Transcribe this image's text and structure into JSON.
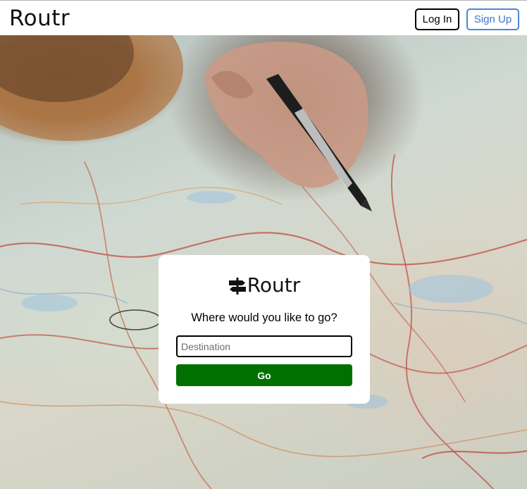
{
  "header": {
    "brand": "Routr",
    "login_label": "Log In",
    "signup_label": "Sign Up"
  },
  "hero": {
    "background": "photo-of-hand-with-pen-over-road-map"
  },
  "card": {
    "logo_icon": "signpost-icon",
    "logo_text": "Routr",
    "prompt": "Where would you like to go?",
    "destination": {
      "value": "",
      "placeholder": "Destination"
    },
    "go_label": "Go"
  },
  "colors": {
    "go_button": "#007100",
    "signup_border": "#4a86d9",
    "signup_text": "#3a78cf"
  }
}
